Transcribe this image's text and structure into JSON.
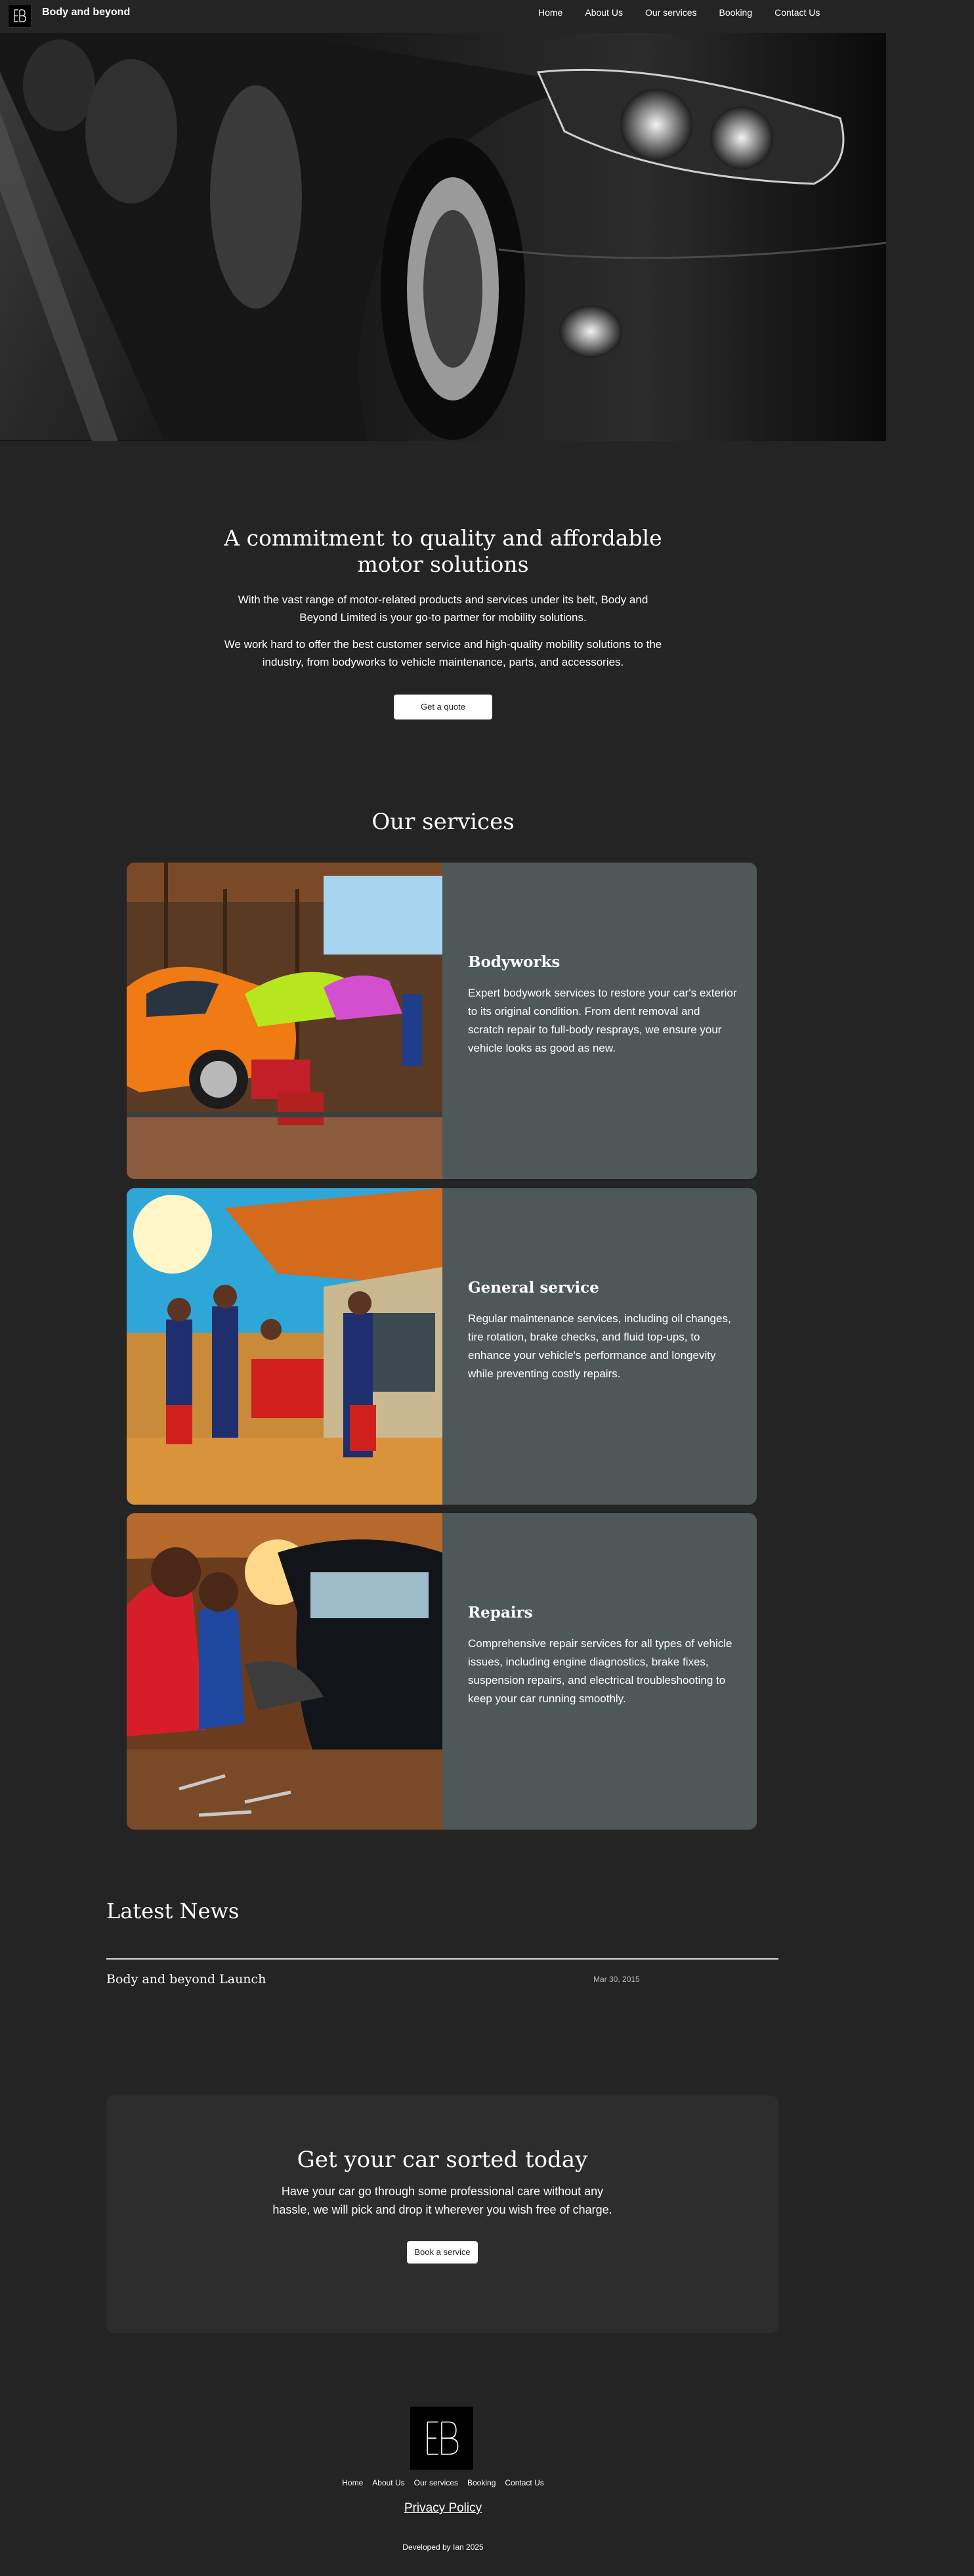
{
  "header": {
    "brand": "Body and beyond",
    "nav": [
      "Home",
      "About Us",
      "Our services",
      "Booking",
      "Contact Us"
    ]
  },
  "hero": {
    "image": "black-sports-car-headlight-photo"
  },
  "commitment": {
    "title": "A commitment to quality and affordable motor solutions",
    "paragraph1": "With the vast range of motor-related products and services under its belt, Body and Beyond Limited is your go-to partner for mobility solutions.",
    "paragraph2": "We work hard to offer the best customer service and high-quality mobility solutions to the industry, from bodyworks to vehicle maintenance, parts, and accessories.",
    "button": "Get a quote"
  },
  "services": {
    "title": "Our services",
    "items": [
      {
        "title": "Bodyworks",
        "description": "Expert bodywork services to restore your car's exterior to its original condition. From dent removal and scratch repair to full-body resprays, we ensure your vehicle looks as good as new.",
        "image": "colorful-cars-in-garage-photo"
      },
      {
        "title": "General service",
        "description": "Regular maintenance services, including oil changes, tire rotation, brake checks, and fluid top-ups, to enhance your vehicle's performance and longevity while preventing costly repairs.",
        "image": "mechanics-working-on-car-photo"
      },
      {
        "title": "Repairs",
        "description": "Comprehensive repair services for all types of vehicle issues, including engine diagnostics, brake fixes, suspension repairs, and electrical troubleshooting to keep your car running smoothly.",
        "image": "mechanics-repairing-engine-photo"
      }
    ]
  },
  "news": {
    "title": "Latest News",
    "items": [
      {
        "title": "Body and beyond Launch",
        "date": "Mar 30, 2015"
      }
    ]
  },
  "cta": {
    "title": "Get your car sorted today",
    "text": "Have your car go through some professional care without any hassle, we will pick and drop it wherever you wish free of charge.",
    "button": "Book a service"
  },
  "footer": {
    "nav": [
      "Home",
      "About Us",
      "Our services",
      "Booking",
      "Contact Us"
    ],
    "privacy": "Privacy Policy",
    "developed": "Developed by Ian 2025"
  },
  "colors": {
    "background": "#242424",
    "card": "#4f5858",
    "cta_background": "#2d2d2d",
    "button": "#ffffff"
  }
}
